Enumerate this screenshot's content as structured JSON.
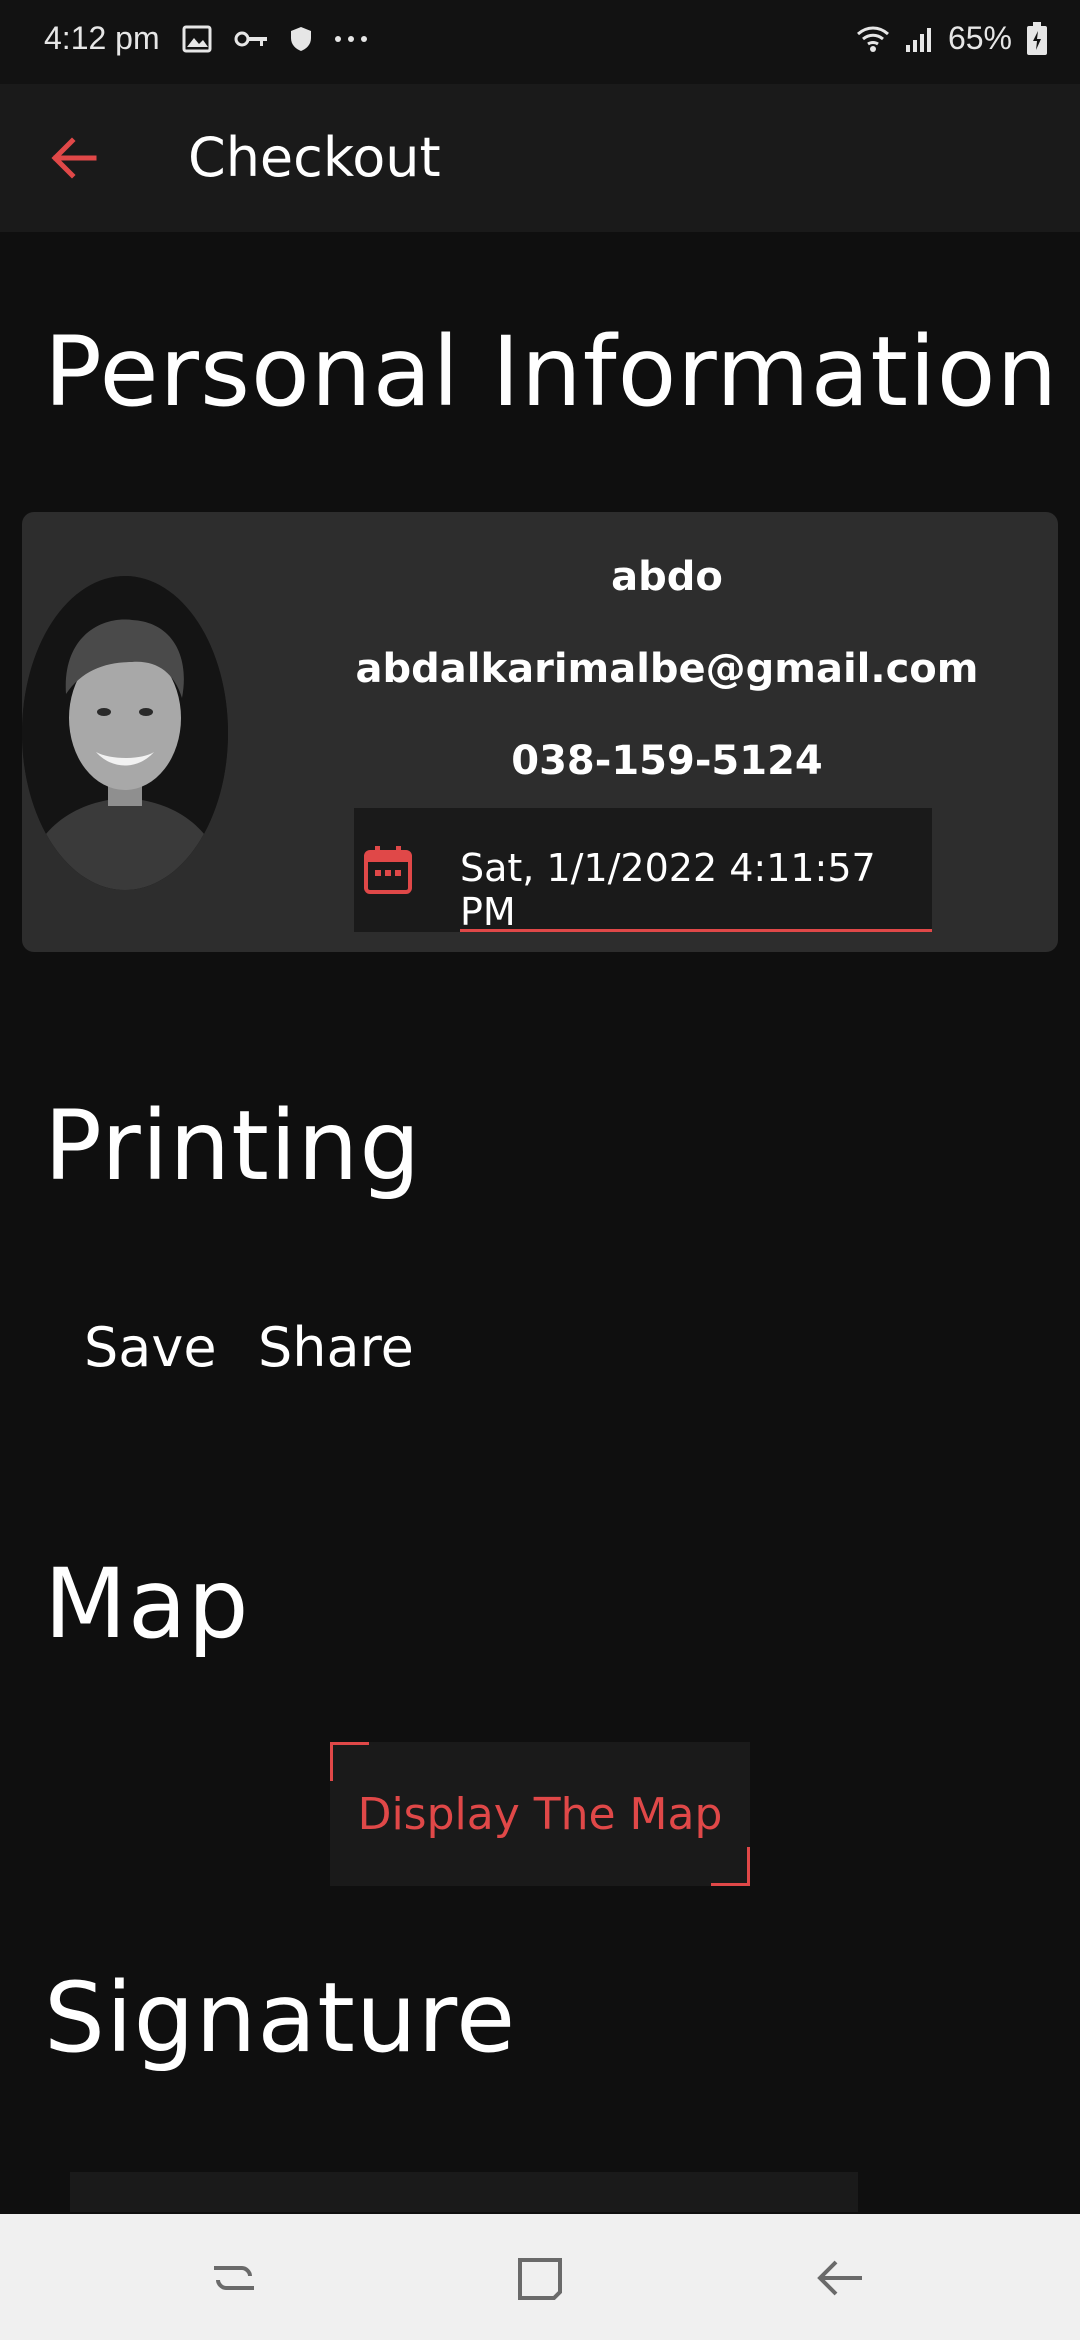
{
  "status_bar": {
    "time": "4:12 pm",
    "battery": "65%",
    "icons_left": [
      "image-icon",
      "key-icon",
      "shield-icon",
      "more-dots-icon"
    ],
    "icons_right": [
      "wifi-icon",
      "signal-icon",
      "battery-icon"
    ]
  },
  "app_bar": {
    "title": "Checkout",
    "back_icon": "arrow-left-icon"
  },
  "sections": {
    "personal": "Personal Information",
    "printing": "Printing",
    "map": "Map",
    "signature": "Signature"
  },
  "personal": {
    "name": "abdo",
    "email": "abdalkarimalbe@gmail.com",
    "phone": "038-159-5124",
    "date": "Sat, 1/1/2022 4:11:57 PM"
  },
  "printing": {
    "save_label": "Save",
    "share_label": "Share"
  },
  "map": {
    "button_label": "Display The Map"
  },
  "colors": {
    "accent": "#e04848",
    "background": "#0f0f0f",
    "card": "#2d2d2d",
    "app_bar": "#1a1a1a"
  }
}
